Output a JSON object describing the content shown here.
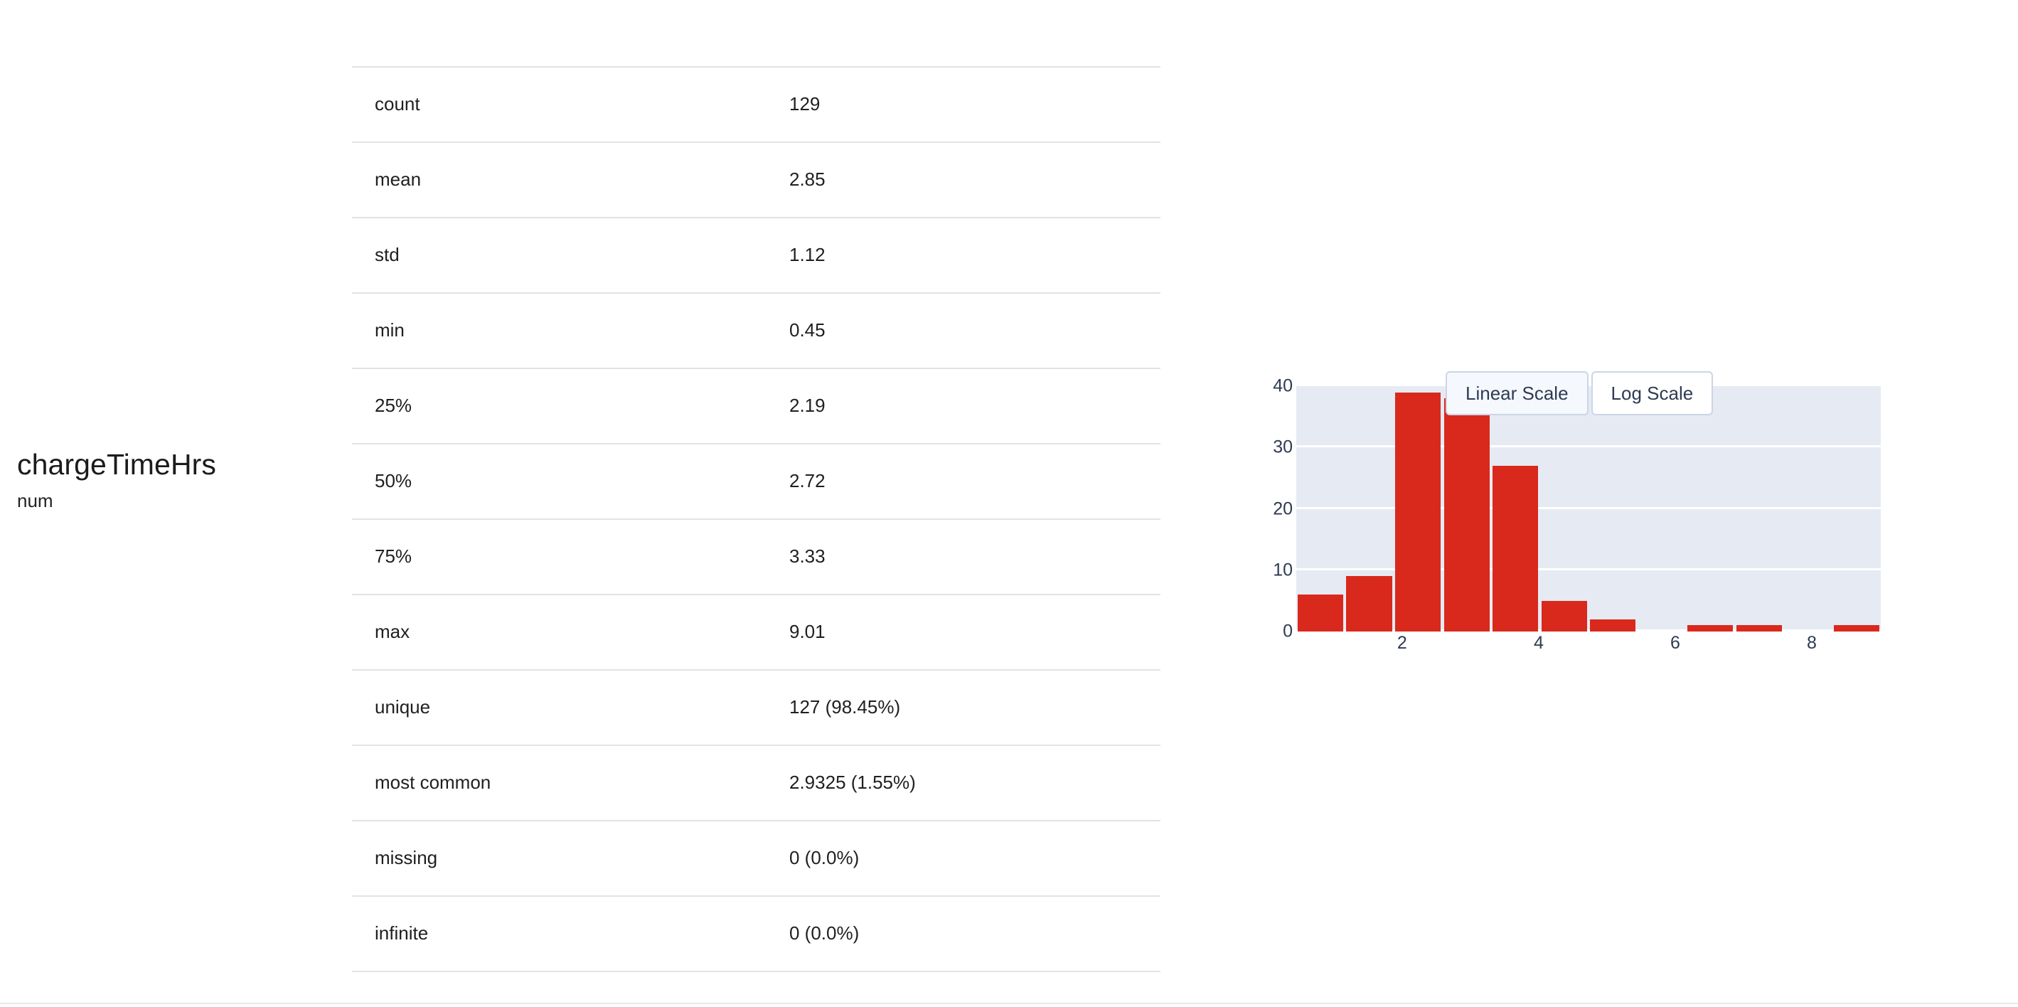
{
  "column": {
    "name": "chargeTimeHrs",
    "dtype": "num"
  },
  "stats": [
    {
      "label": "count",
      "value": "129"
    },
    {
      "label": "mean",
      "value": "2.85"
    },
    {
      "label": "std",
      "value": "1.12"
    },
    {
      "label": "min",
      "value": "0.45"
    },
    {
      "label": "25%",
      "value": "2.19"
    },
    {
      "label": "50%",
      "value": "2.72"
    },
    {
      "label": "75%",
      "value": "3.33"
    },
    {
      "label": "max",
      "value": "9.01"
    },
    {
      "label": "unique",
      "value": "127 (98.45%)"
    },
    {
      "label": "most common",
      "value": "2.9325 (1.55%)"
    },
    {
      "label": "missing",
      "value": "0 (0.0%)"
    },
    {
      "label": "infinite",
      "value": "0 (0.0%)"
    }
  ],
  "histogram": {
    "scale_buttons": [
      {
        "id": "linear",
        "label": "Linear Scale",
        "active": true
      },
      {
        "id": "log",
        "label": "Log Scale",
        "active": false
      }
    ],
    "colors": {
      "bar": "#d9291c",
      "plot_background": "#e6eaf3",
      "gridline": "#ffffff",
      "tick_text": "#2f3b52"
    }
  },
  "chart_data": {
    "type": "bar",
    "title": "",
    "xlabel": "",
    "ylabel": "",
    "grid": true,
    "legend": null,
    "xlim": [
      0.45,
      9.01
    ],
    "ylim": [
      0,
      40
    ],
    "yticks": [
      0,
      10,
      20,
      30,
      40
    ],
    "xticks": [
      2,
      4,
      6,
      8
    ],
    "bin_width": 0.7133,
    "bin_starts": [
      0.45,
      1.1633,
      1.8767,
      2.59,
      3.3033,
      4.0167,
      4.73,
      5.4433,
      6.1567,
      6.87,
      7.5833,
      8.2967
    ],
    "categories": [
      "0.45-1.16",
      "1.16-1.88",
      "1.88-2.59",
      "2.59-3.30",
      "3.30-4.02",
      "4.02-4.73",
      "4.73-5.44",
      "5.44-6.16",
      "6.16-6.87",
      "6.87-7.58",
      "7.58-8.30",
      "8.30-9.01"
    ],
    "values": [
      6,
      9,
      39,
      38,
      27,
      5,
      2,
      0,
      1,
      1,
      0,
      1
    ]
  }
}
